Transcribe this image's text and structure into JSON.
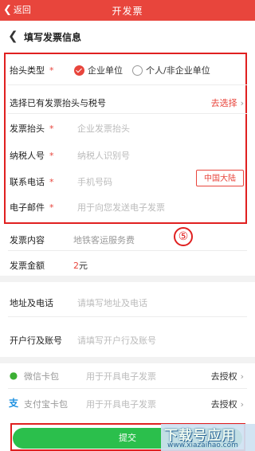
{
  "topbar": {
    "back_label": "返回",
    "title": "开发票"
  },
  "header": {
    "title": "填写发票信息"
  },
  "form": {
    "header_type": {
      "label": "抬头类型",
      "option_company": "企业单位",
      "option_personal": "个人/非企业单位",
      "selected": "企业单位"
    },
    "select_existing": {
      "label": "选择已有发票抬头与税号",
      "action": "去选择"
    },
    "invoice_header": {
      "label": "发票抬头",
      "placeholder": "企业发票抬头"
    },
    "taxpayer_id": {
      "label": "纳税人号",
      "placeholder": "纳税人识别号"
    },
    "phone": {
      "label": "联系电话",
      "placeholder": "手机号码",
      "region": "中国大陆"
    },
    "email": {
      "label": "电子邮件",
      "placeholder": "用于向您发送电子发票"
    },
    "required_mark": "*"
  },
  "annotation": {
    "marker": "⑤"
  },
  "details": {
    "content": {
      "label": "发票内容",
      "value": "地铁客运服务费"
    },
    "amount": {
      "label": "发票金额",
      "value": "2",
      "unit": "元"
    }
  },
  "optional": {
    "address": {
      "label": "地址及电话",
      "placeholder": "请填写地址及电话"
    },
    "bank": {
      "label": "开户行及账号",
      "placeholder": "请填写开户行及账号"
    }
  },
  "wallets": [
    {
      "label": "微信卡包",
      "desc": "用于开具电子发票",
      "action": "去授权",
      "icon": "wechat-icon"
    },
    {
      "label": "支付宝卡包",
      "desc": "用于开具电子发票",
      "action": "去授权",
      "icon": "alipay-icon"
    }
  ],
  "submit": {
    "label": "提交"
  },
  "watermark": {
    "main": "下载号应用",
    "sub": "www.xiazaihao.com"
  },
  "colors": {
    "brand_red": "#e8453c",
    "submit_green": "#2bbf4c",
    "annotation_red": "#e02020"
  }
}
